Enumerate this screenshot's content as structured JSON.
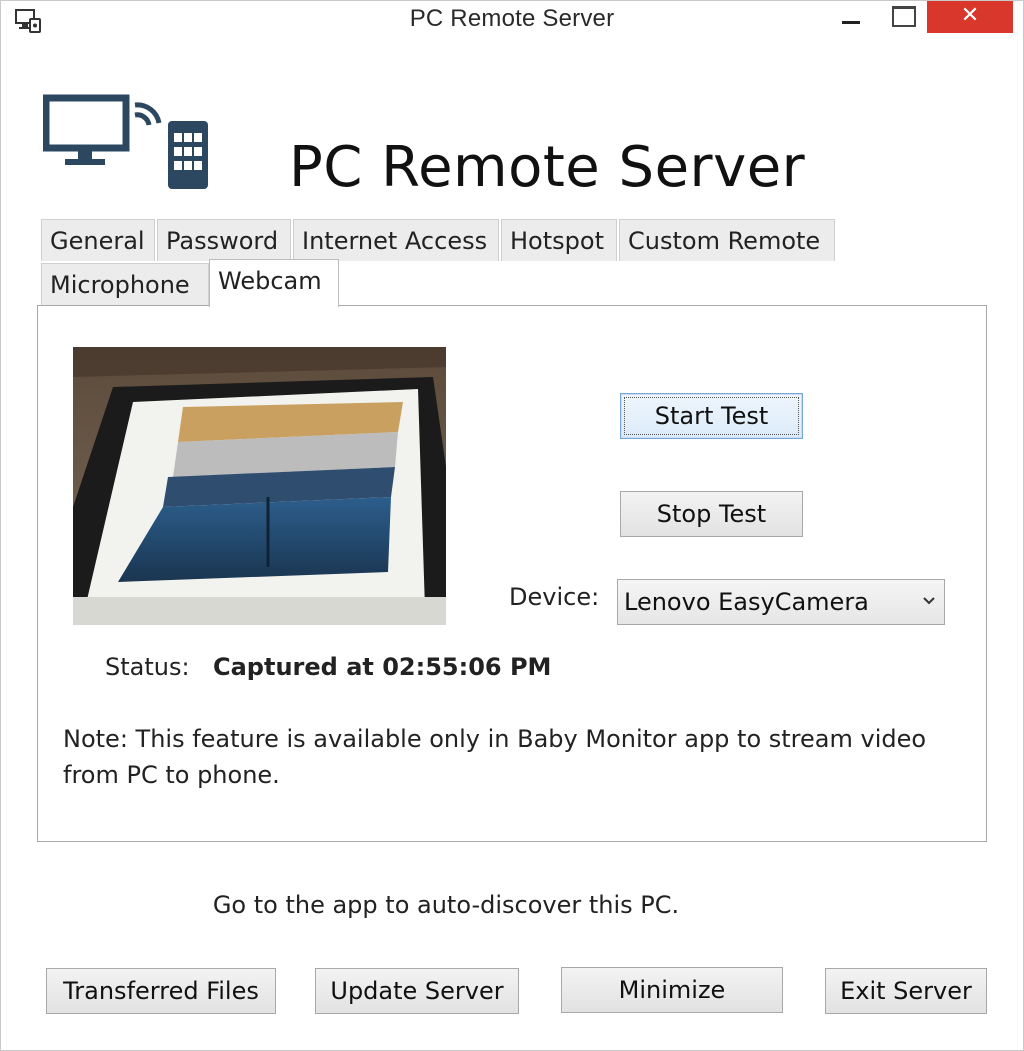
{
  "window": {
    "title": "PC Remote Server",
    "close_glyph": "✕"
  },
  "header": {
    "heading": "PC Remote Server",
    "logo_icon": "monitor-phone-wireless-icon"
  },
  "tabs": [
    {
      "label": "General",
      "active": false
    },
    {
      "label": "Password",
      "active": false
    },
    {
      "label": "Internet Access",
      "active": false
    },
    {
      "label": "Hotspot",
      "active": false
    },
    {
      "label": "Custom Remote",
      "active": false
    },
    {
      "label": "Microphone",
      "active": false
    },
    {
      "label": "Webcam",
      "active": true
    }
  ],
  "webcam": {
    "start_test_label": "Start Test",
    "stop_test_label": "Stop Test",
    "device_label": "Device:",
    "device_value": "Lenovo EasyCamera",
    "status_label": "Status:",
    "status_value": "Captured at 02:55:06 PM",
    "note": "Note: This feature is available only in Baby Monitor app to stream video from PC to phone."
  },
  "footer": {
    "hint": "Go to the app to auto-discover this PC.",
    "transferred_files_label": "Transferred Files",
    "update_server_label": "Update Server",
    "minimize_label": "Minimize",
    "exit_server_label": "Exit Server"
  },
  "colors": {
    "close_button": "#d9372c",
    "logo_blue": "#2c4760",
    "focus_blue": "#7aa6d6"
  }
}
